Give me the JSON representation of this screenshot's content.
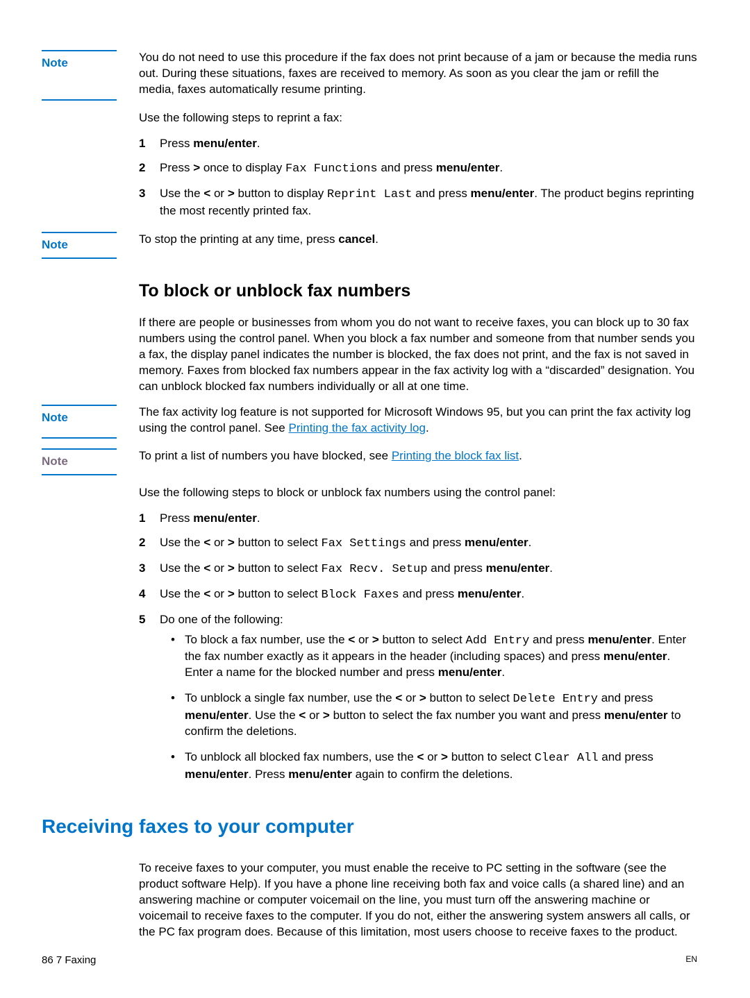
{
  "notes": {
    "n1_label": "Note",
    "n1_body": "You do not need to use this procedure if the fax does not print because of a jam or because the media runs out. During these situations, faxes are received to memory. As soon as you clear the jam or refill the media, faxes automatically resume printing.",
    "n2_label": "Note",
    "n2_body_pre": "To stop the printing at any time, press ",
    "n2_body_bold": "cancel",
    "n2_body_post": ".",
    "n3_label": "Note",
    "n3_body_pre": "The fax activity log feature is not supported for Microsoft Windows 95, but you can print the fax activity log using the control panel. See ",
    "n3_link": "Printing the fax activity log",
    "n3_post": ".",
    "n4_label": "Note",
    "n4_body_pre": "To print a list of numbers you have blocked, see ",
    "n4_link": "Printing the block fax list",
    "n4_post": "."
  },
  "section1": {
    "intro": "Use the following steps to reprint a fax:",
    "s1_num": "1",
    "s1_a": "Press ",
    "s1_b": "menu/enter",
    "s1_c": ".",
    "s2_num": "2",
    "s2_a": "Press ",
    "s2_b": ">",
    "s2_c": " once to display ",
    "s2_mono": "Fax Functions",
    "s2_d": " and press ",
    "s2_e": "menu/enter",
    "s2_f": ".",
    "s3_num": "3",
    "s3_a": "Use the ",
    "s3_b": "<",
    "s3_c": " or ",
    "s3_d": ">",
    "s3_e": " button to display ",
    "s3_mono": "Reprint Last",
    "s3_f": " and press ",
    "s3_g": "menu/enter",
    "s3_h": ". The product begins reprinting the most recently printed fax."
  },
  "section2": {
    "heading": "To block or unblock fax numbers",
    "para": "If there are people or businesses from whom you do not want to receive faxes, you can block up to 30 fax numbers using the control panel. When you block a fax number and someone from that number sends you a fax, the display panel indicates the number is blocked, the fax does not print, and the fax is not saved in memory. Faxes from blocked fax numbers appear in the fax activity log with a “discarded” designation. You can unblock blocked fax numbers individually or all at one time.",
    "intro": "Use the following steps to block or unblock fax numbers using the control panel:",
    "steps": {
      "s1_num": "1",
      "s1": "Press ",
      "s1b": "menu/enter",
      "s1c": ".",
      "s2_num": "2",
      "s2a": "Use the ",
      "s2b": "<",
      "s2c": " or ",
      "s2d": ">",
      "s2e": " button to select ",
      "s2mono": "Fax Settings",
      "s2f": " and press ",
      "s2g": "menu/enter",
      "s2h": ".",
      "s3_num": "3",
      "s3a": "Use the ",
      "s3b": "<",
      "s3c": " or ",
      "s3d": ">",
      "s3e": " button to select ",
      "s3mono": "Fax Recv. Setup",
      "s3f": " and press ",
      "s3g": "menu/enter",
      "s3h": ".",
      "s4_num": "4",
      "s4a": "Use the ",
      "s4b": "<",
      "s4c": " or ",
      "s4d": ">",
      "s4e": " button to select ",
      "s4mono": "Block Faxes",
      "s4f": " and press ",
      "s4g": "menu/enter",
      "s4h": ".",
      "s5_num": "5",
      "s5": "Do one of the following:"
    },
    "bullets": {
      "b1": {
        "a": "To block a fax number, use the ",
        "b": "<",
        "c": " or ",
        "d": ">",
        "e": " button to select ",
        "mono": "Add Entry",
        "f": " and press ",
        "g": "menu/enter",
        "h": ". Enter the fax number exactly as it appears in the header (including spaces) and press ",
        "i": "menu/enter",
        "j": ". Enter a name for the blocked number and press ",
        "k": "menu/enter",
        "l": "."
      },
      "b2": {
        "a": "To unblock a single fax number, use the ",
        "b": "<",
        "c": " or ",
        "d": ">",
        "e": " button to select ",
        "mono": "Delete Entry",
        "f": " and press ",
        "g": "menu/enter",
        "h": ". Use the ",
        "i": "<",
        "j": " or ",
        "k": ">",
        "l": " button to select the fax number you want and press ",
        "m": "menu/enter",
        "n": " to confirm the deletions."
      },
      "b3": {
        "a": "To unblock all blocked fax numbers, use the ",
        "b": "<",
        "c": " or ",
        "d": ">",
        "e": " button to select ",
        "mono": "Clear All",
        "f": " and press ",
        "g": "menu/enter",
        "h": ". Press ",
        "i": "menu/enter",
        "j": " again to confirm the deletions."
      }
    }
  },
  "section3": {
    "heading": "Receiving faxes to your computer",
    "para": "To receive faxes to your computer, you must enable the receive to PC setting in the software (see the product software Help). If you have a phone line receiving both fax and voice calls (a shared line) and an answering machine or computer voicemail on the line, you must turn off the answering machine or voicemail to receive faxes to the computer. If you do not, either the answering system answers all calls, or the PC fax program does. Because of this limitation, most users choose to receive faxes to the product."
  },
  "footer": {
    "left_page": "86",
    "left_chapter": "   7 Faxing",
    "right": "EN"
  }
}
